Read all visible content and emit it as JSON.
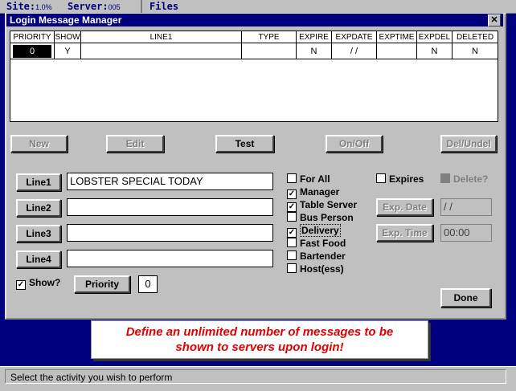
{
  "top": {
    "site_label": "Site:",
    "site_value": "1.0%",
    "server_label": "Server:",
    "server_value": "005",
    "files_label": "Files"
  },
  "window": {
    "title": "Login Message Manager",
    "close_label": "✕"
  },
  "grid": {
    "headers": [
      "PRIORITY",
      "SHOW",
      "LINE1",
      "TYPE",
      "EXPIRE",
      "EXPDATE",
      "EXPTIME",
      "EXPDEL",
      "DELETED"
    ],
    "row": [
      "0",
      "Y",
      "",
      "",
      "N",
      "/ /",
      "",
      "N",
      "N"
    ]
  },
  "actions": {
    "new": "New",
    "edit": "Edit",
    "test": "Test",
    "onoff": "On/Off",
    "delundel": "Del/Undel"
  },
  "lines": [
    {
      "button": "Line1",
      "value": "LOBSTER SPECIAL TODAY"
    },
    {
      "button": "Line2",
      "value": ""
    },
    {
      "button": "Line3",
      "value": ""
    },
    {
      "button": "Line4",
      "value": ""
    }
  ],
  "show": {
    "label": "Show?",
    "checked": true
  },
  "priority": {
    "button": "Priority",
    "value": "0"
  },
  "audience": [
    {
      "label": "For All",
      "checked": false
    },
    {
      "label": "Manager",
      "checked": true
    },
    {
      "label": "Table Server",
      "checked": true
    },
    {
      "label": "Bus Person",
      "checked": false
    },
    {
      "label": "Delivery",
      "checked": true
    },
    {
      "label": "Fast Food",
      "checked": false
    },
    {
      "label": "Bartender",
      "checked": false
    },
    {
      "label": "Host(ess)",
      "checked": false
    }
  ],
  "expires": {
    "label": "Expires",
    "checked": false
  },
  "delete": {
    "label": "Delete?",
    "checked": false
  },
  "expdate": {
    "button": "Exp. Date",
    "value": "/ /"
  },
  "exptime": {
    "button": "Exp. Time",
    "value": "00:00"
  },
  "done": "Done",
  "banner": {
    "line1": "Define an unlimited number of messages to be",
    "line2": "shown to servers upon login!"
  },
  "status": "Select the activity you wish to perform"
}
